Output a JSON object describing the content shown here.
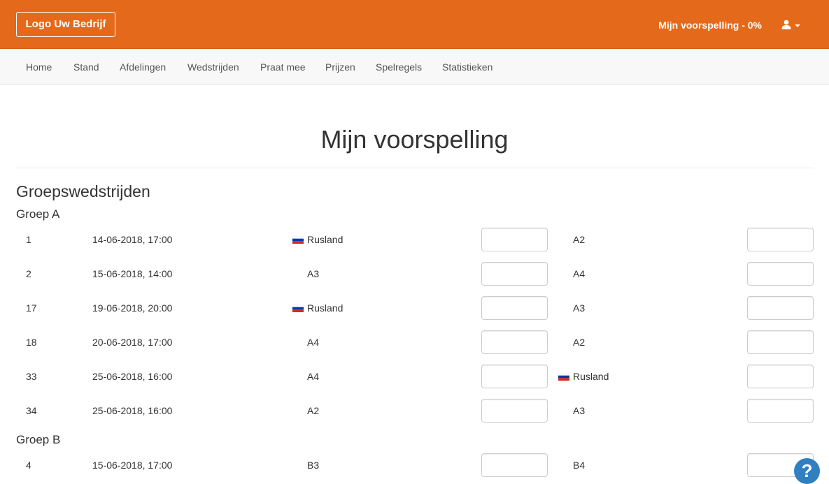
{
  "header": {
    "logo_label": "Logo Uw Bedrijf",
    "progress_label": "Mijn voorspelling - 0%",
    "user_icon": "user-icon"
  },
  "nav": {
    "items": [
      {
        "label": "Home"
      },
      {
        "label": "Stand"
      },
      {
        "label": "Afdelingen"
      },
      {
        "label": "Wedstrijden"
      },
      {
        "label": "Praat mee"
      },
      {
        "label": "Prijzen"
      },
      {
        "label": "Spelregels"
      },
      {
        "label": "Statistieken"
      }
    ]
  },
  "main": {
    "title": "Mijn voorspelling",
    "section_title": "Groepswedstrijden",
    "groups": [
      {
        "name": "Groep A",
        "matches": [
          {
            "number": "1",
            "datetime": "14-06-2018, 17:00",
            "home": "Rusland",
            "away": "A2"
          },
          {
            "number": "2",
            "datetime": "15-06-2018, 14:00",
            "home": "A3",
            "away": "A4"
          },
          {
            "number": "17",
            "datetime": "19-06-2018, 20:00",
            "home": "Rusland",
            "away": "A3"
          },
          {
            "number": "18",
            "datetime": "20-06-2018, 17:00",
            "home": "A4",
            "away": "A2"
          },
          {
            "number": "33",
            "datetime": "25-06-2018, 16:00",
            "home": "A4",
            "away": "Rusland"
          },
          {
            "number": "34",
            "datetime": "25-06-2018, 16:00",
            "home": "A2",
            "away": "A3"
          }
        ]
      },
      {
        "name": "Groep B",
        "matches": [
          {
            "number": "4",
            "datetime": "15-06-2018, 17:00",
            "home": "B3",
            "away": "B4"
          }
        ]
      }
    ]
  },
  "help": {
    "label": "?"
  },
  "colors": {
    "brand": "#e5691a",
    "help": "#2f7fc1",
    "flag_russia": [
      "#ffffff",
      "#0039a6",
      "#d52b1e"
    ]
  }
}
